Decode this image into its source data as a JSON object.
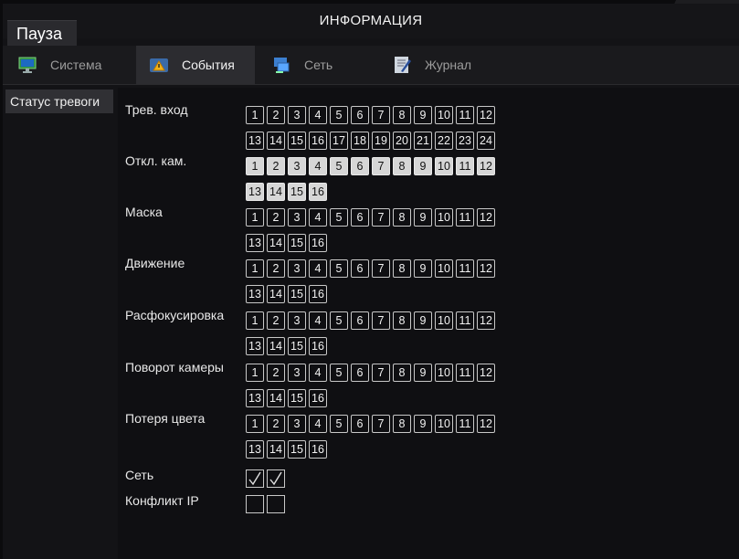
{
  "window": {
    "title": "ИНФОРМАЦИЯ",
    "pause_label": "Пауза"
  },
  "tabs": [
    {
      "label": "Система",
      "icon": "monitor-icon",
      "active": false
    },
    {
      "label": "События",
      "icon": "warning-icon",
      "active": true
    },
    {
      "label": "Сеть",
      "icon": "network-icon",
      "active": false
    },
    {
      "label": "Журнал",
      "icon": "log-icon",
      "active": false
    }
  ],
  "sidebar": {
    "items": [
      {
        "label": "Статус тревоги"
      }
    ]
  },
  "rows": [
    {
      "label": "Трев. вход",
      "channels": [
        "1",
        "2",
        "3",
        "4",
        "5",
        "6",
        "7",
        "8",
        "9",
        "10",
        "11",
        "12",
        "13",
        "14",
        "15",
        "16",
        "17",
        "18",
        "19",
        "20",
        "21",
        "22",
        "23",
        "24"
      ],
      "highlighted": []
    },
    {
      "label": "Откл. кам.",
      "channels": [
        "1",
        "2",
        "3",
        "4",
        "5",
        "6",
        "7",
        "8",
        "9",
        "10",
        "11",
        "12",
        "13",
        "14",
        "15",
        "16"
      ],
      "highlighted": [
        "1",
        "2",
        "3",
        "4",
        "5",
        "6",
        "7",
        "8",
        "9",
        "10",
        "11",
        "12",
        "13",
        "14",
        "15",
        "16"
      ]
    },
    {
      "label": "Маска",
      "channels": [
        "1",
        "2",
        "3",
        "4",
        "5",
        "6",
        "7",
        "8",
        "9",
        "10",
        "11",
        "12",
        "13",
        "14",
        "15",
        "16"
      ],
      "highlighted": []
    },
    {
      "label": "Движение",
      "channels": [
        "1",
        "2",
        "3",
        "4",
        "5",
        "6",
        "7",
        "8",
        "9",
        "10",
        "11",
        "12",
        "13",
        "14",
        "15",
        "16"
      ],
      "highlighted": []
    },
    {
      "label": "Расфокусировка",
      "channels": [
        "1",
        "2",
        "3",
        "4",
        "5",
        "6",
        "7",
        "8",
        "9",
        "10",
        "11",
        "12",
        "13",
        "14",
        "15",
        "16"
      ],
      "highlighted": []
    },
    {
      "label": "Поворот камеры",
      "channels": [
        "1",
        "2",
        "3",
        "4",
        "5",
        "6",
        "7",
        "8",
        "9",
        "10",
        "11",
        "12",
        "13",
        "14",
        "15",
        "16"
      ],
      "highlighted": []
    },
    {
      "label": "Потеря цвета",
      "channels": [
        "1",
        "2",
        "3",
        "4",
        "5",
        "6",
        "7",
        "8",
        "9",
        "10",
        "11",
        "12",
        "13",
        "14",
        "15",
        "16"
      ],
      "highlighted": []
    }
  ],
  "network": {
    "label": "Сеть",
    "checks": [
      true,
      true
    ]
  },
  "ip_conflict": {
    "label": "Конфликт IP",
    "checks": [
      false,
      false
    ]
  },
  "colors": {
    "background": "#131316",
    "active_tab": "#2c2c30",
    "box_border": "#c8c8c8",
    "box_highlight": "#d6d6d6"
  }
}
